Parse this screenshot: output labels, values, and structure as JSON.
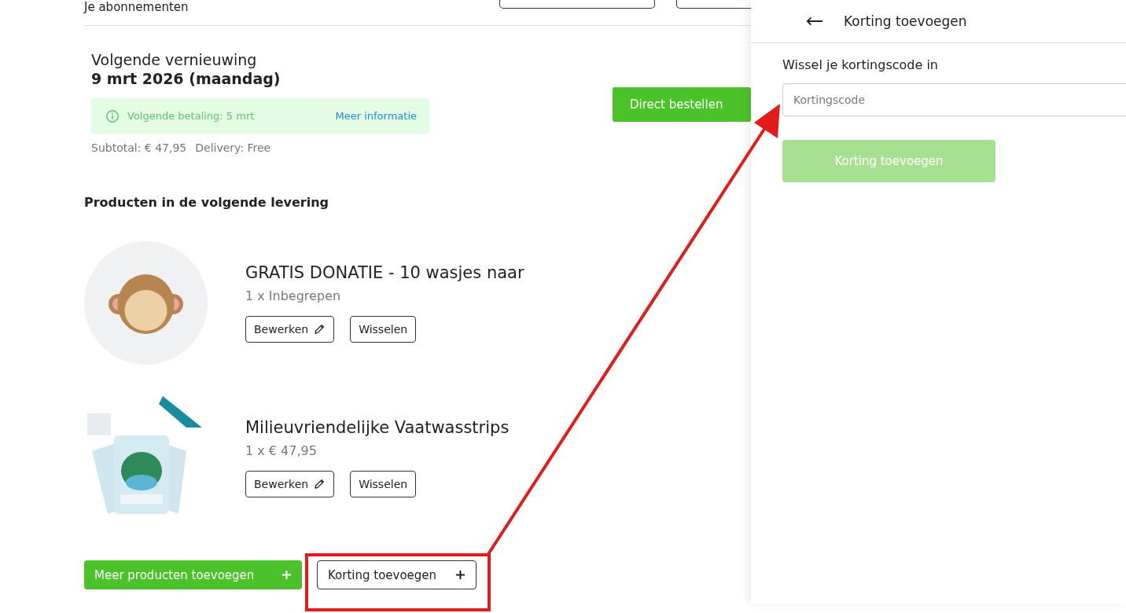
{
  "header": {
    "title": "Je abonnementen"
  },
  "renewal": {
    "label": "Volgende vernieuwing",
    "date": "9 mrt 2026 (maandag)",
    "notice": {
      "text": "Volgende betaling: 5 mrt",
      "link": "Meer informatie"
    },
    "totals": [
      "Subtotal: € 47,95",
      "Delivery: Free"
    ],
    "order_button": "Direct bestellen"
  },
  "section_title": "Producten in de volgende levering",
  "products": [
    {
      "name": "GRATIS DONATIE - 10 wasjes naar",
      "quantity": "1 x Inbegrepen",
      "actions": [
        {
          "label": "Bewerken",
          "kind": "edit"
        },
        {
          "label": "Wisselen",
          "kind": "plain"
        }
      ]
    },
    {
      "name": "Milieuvriendelijke Vaatwasstrips",
      "quantity": "1 x € 47,95",
      "actions": [
        {
          "label": "Bewerken",
          "kind": "edit"
        },
        {
          "label": "Wisselen",
          "kind": "plain"
        }
      ]
    }
  ],
  "footer_buttons": [
    {
      "label": "Meer producten toevoegen",
      "kind": "primary"
    },
    {
      "label": "Korting toevoegen",
      "kind": "outline"
    }
  ],
  "drawer": {
    "title": "Korting toevoegen",
    "label": "Wissel je kortingscode in",
    "field": {
      "placeholder": "Kortingscode"
    },
    "submit": {
      "label": "Korting toevoegen",
      "disabled": true
    }
  }
}
